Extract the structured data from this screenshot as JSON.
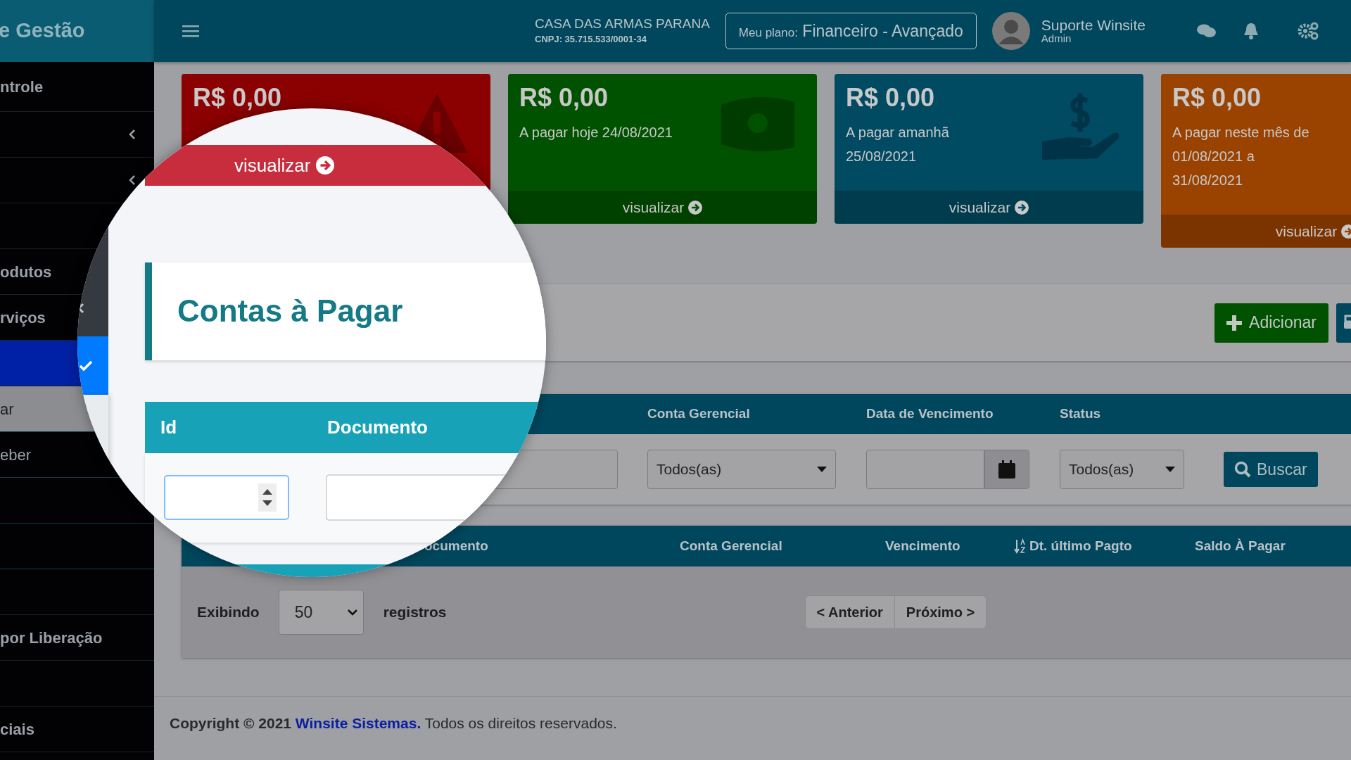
{
  "sidebar": {
    "brand": "e Gestão",
    "items": [
      {
        "kind": "item",
        "label": "ntrole",
        "selected": false
      },
      {
        "kind": "group",
        "selected": false
      },
      {
        "kind": "group",
        "selected": false
      },
      {
        "kind": "item",
        "selected": false
      },
      {
        "kind": "item",
        "label": "odutos",
        "selected": false
      },
      {
        "kind": "item",
        "label": "rviços",
        "selected": false
      },
      {
        "kind": "item",
        "selected": true
      },
      {
        "kind": "subitem",
        "label": "ar",
        "selected": true
      },
      {
        "kind": "subitem",
        "label": "eber",
        "selected": false
      },
      {
        "kind": "subitem",
        "selected": false
      },
      {
        "kind": "subitem",
        "selected": false
      },
      {
        "kind": "item",
        "selected": false
      },
      {
        "kind": "item",
        "label": "por Liberação",
        "selected": false
      },
      {
        "kind": "item",
        "selected": false
      },
      {
        "kind": "item",
        "label": "ciais",
        "selected": false
      }
    ]
  },
  "topbar": {
    "company": "CASA DAS ARMAS PARANA",
    "cnpj": "CNPJ: 35.715.533/0001-34",
    "plan_label": "Meu plano:",
    "plan": "Financeiro - Avançado",
    "user": "Suporte Winsite",
    "role": "Admin"
  },
  "cards": [
    {
      "amount": "R$ 0,00",
      "kind": "warning",
      "color": "#8b0000"
    },
    {
      "amount": "R$ 0,00",
      "subtitle": [
        "A pagar hoje 24/08/2021"
      ],
      "link": "visualizar",
      "kind": "money",
      "color": "#005200"
    },
    {
      "amount": "R$ 0,00",
      "subtitle": [
        "A pagar amanhã",
        "25/08/2021"
      ],
      "link": "visualizar",
      "kind": "hand",
      "color": "#004a62"
    },
    {
      "amount": "R$ 0,00",
      "subtitle": [
        "A pagar neste mês de",
        "01/08/2021 a",
        "31/08/2021"
      ],
      "link": "visualizar",
      "kind": "plain",
      "color": "#9a4200"
    }
  ],
  "page": {
    "actions": [
      {
        "kind": "add",
        "label": "Adicionar"
      },
      {
        "kind": "more"
      }
    ]
  },
  "filter": {
    "columns": [
      "Conta Gerencial",
      "Data de Vencimento",
      "Status"
    ],
    "conta": "Todos(as)",
    "status": "Todos(as)",
    "search": "Buscar"
  },
  "results": {
    "columns": [
      {
        "label": "ocumento",
        "sortable": false
      },
      {
        "label": "Conta Gerencial",
        "sortable": false
      },
      {
        "label": "Vencimento",
        "sortable": false
      },
      {
        "label": "Dt. último Pagto",
        "sortable": true
      },
      {
        "label": "Saldo À Pagar",
        "sortable": false
      }
    ],
    "showing_label": "Exibindo",
    "page_size": "50",
    "records_label": "registros",
    "prev": "< Anterior",
    "next": "Próximo >"
  },
  "footer": {
    "prefix": "Copyright © 2021",
    "link": "Winsite Sistemas.",
    "suffix": "Todos os direitos reservados."
  },
  "magnifier": {
    "card_link": "visualizar",
    "title": "Contas à Pagar",
    "columns": [
      "Id",
      "Documento"
    ]
  }
}
